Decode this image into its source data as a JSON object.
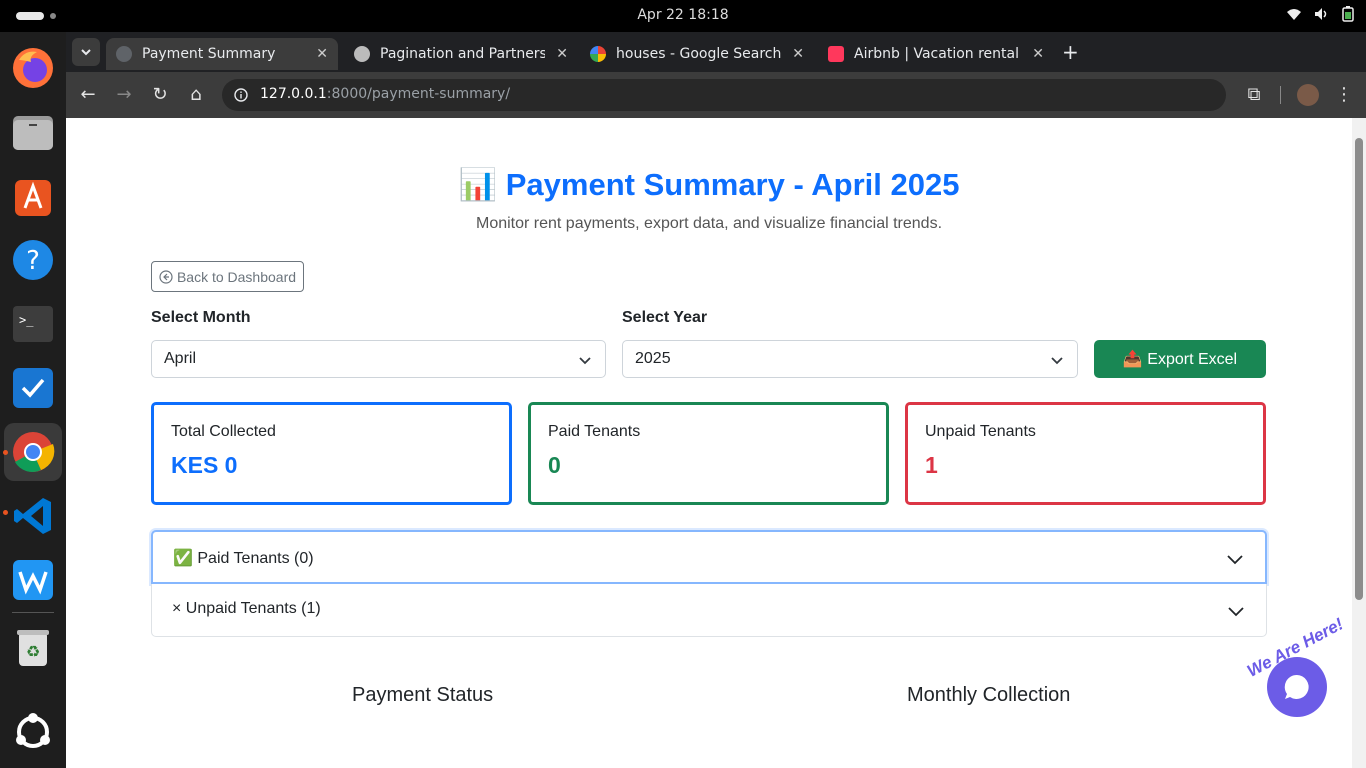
{
  "system": {
    "clock": "Apr 22  18:18"
  },
  "browser": {
    "tabs": [
      {
        "label": "Payment Summary",
        "active": true
      },
      {
        "label": "Pagination and Partners",
        "active": false
      },
      {
        "label": "houses - Google Search",
        "active": false
      },
      {
        "label": "Airbnb | Vacation rentals",
        "active": false
      }
    ],
    "new_tab": "+",
    "url_host": "127.0.0.1",
    "url_path": ":8000/payment-summary/"
  },
  "page": {
    "title": "📊 Payment Summary - April 2025",
    "subtitle": "Monitor rent payments, export data, and visualize financial trends.",
    "back_button": "Back to Dashboard",
    "month_label": "Select Month",
    "month_value": "April",
    "year_label": "Select Year",
    "year_value": "2025",
    "export_button": "📤 Export Excel",
    "cards": {
      "total": {
        "label": "Total Collected",
        "value": "KES 0",
        "color": "#0d6efd"
      },
      "paid": {
        "label": "Paid Tenants",
        "value": "0",
        "color": "#198754"
      },
      "unpaid": {
        "label": "Unpaid Tenants",
        "value": "1",
        "color": "#dc3545"
      }
    },
    "accordion": {
      "paid": "✅ Paid Tenants (0)",
      "unpaid": "× Unpaid Tenants (1)"
    },
    "sections": {
      "status": "Payment Status",
      "monthly": "Monthly Collection"
    },
    "chat_badge": "We Are Here!"
  }
}
